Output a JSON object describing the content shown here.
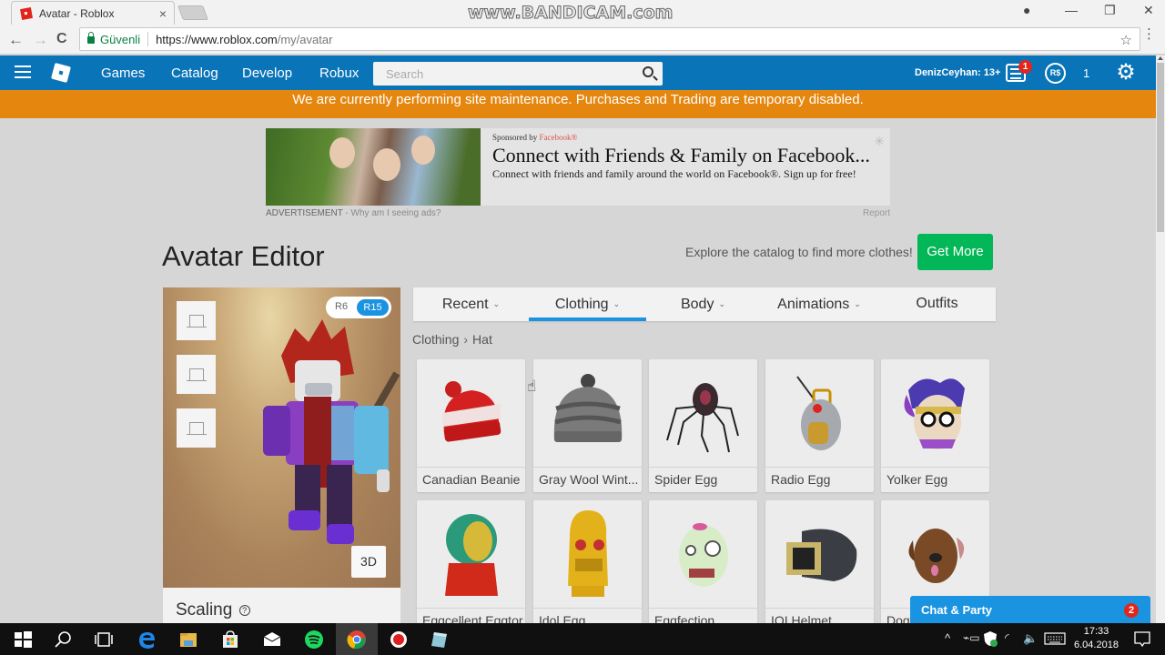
{
  "browser": {
    "tab_title": "Avatar - Roblox",
    "tab_close": "×",
    "watermark": "www.BANDICAM.com",
    "window_controls": {
      "account": "●",
      "minimize": "—",
      "restore": "❐",
      "close": "✕"
    },
    "nav": {
      "back": "←",
      "forward": "→",
      "reload": "C"
    },
    "secure_label": "Güvenli",
    "url_host": "https://www.roblox.com",
    "url_path": "/my/avatar",
    "bookmark_star": "☆",
    "menu": "⋮"
  },
  "header": {
    "nav_links": [
      "Games",
      "Catalog",
      "Develop",
      "Robux"
    ],
    "search_placeholder": "Search",
    "username": "DenizCeyhan: 13+",
    "messages_badge": "1",
    "robux_symbol": "R$",
    "robux_count": "1",
    "settings_icon": "⚙"
  },
  "maintenance_banner": "We are currently performing site maintenance. Purchases and Trading are temporary disabled.",
  "ad": {
    "sponsored_prefix": "Sponsored by ",
    "sponsor": "Facebook®",
    "headline": "Connect with Friends & Family on Facebook...",
    "subline": "Connect with friends and family around the world on Facebook®. Sign up for free!",
    "advertisement_label": "ADVERTISEMENT",
    "why_label": " - Why am I seeing ads?",
    "report_label": "Report"
  },
  "editor": {
    "title": "Avatar Editor",
    "explore_text": "Explore the catalog to find more clothes!",
    "get_more_label": "Get More",
    "rig": {
      "options": [
        "R6",
        "R15"
      ],
      "selected": "R15"
    },
    "view_3d_label": "3D",
    "scaling_label": "Scaling",
    "help_icon": "?",
    "tabs": [
      {
        "label": "Recent",
        "caret": "⌄",
        "active": false
      },
      {
        "label": "Clothing",
        "caret": "⌄",
        "active": true
      },
      {
        "label": "Body",
        "caret": "⌄",
        "active": false
      },
      {
        "label": "Animations",
        "caret": "⌄",
        "active": false
      },
      {
        "label": "Outfits",
        "caret": "",
        "active": false
      }
    ],
    "breadcrumb": [
      "Clothing",
      "Hat"
    ],
    "breadcrumb_sep": "›",
    "items": [
      {
        "name": "Canadian Beanie"
      },
      {
        "name": "Gray Wool Wint..."
      },
      {
        "name": "Spider Egg"
      },
      {
        "name": "Radio Egg"
      },
      {
        "name": "Yolker Egg"
      },
      {
        "name": "Eggcellent Eggtor"
      },
      {
        "name": "Idol Egg"
      },
      {
        "name": "Eggfection"
      },
      {
        "name": "IOI Helmet"
      },
      {
        "name": "Dog..."
      }
    ]
  },
  "chat": {
    "label": "Chat & Party",
    "badge": "2"
  },
  "taskbar": {
    "time": "17:33",
    "date": "6.04.2018"
  },
  "colors": {
    "header_blue": "#0a74b8",
    "banner_orange": "#e5870f",
    "get_more_green": "#02b757",
    "accent_blue": "#1a93e0",
    "badge_red": "#e1261c"
  }
}
